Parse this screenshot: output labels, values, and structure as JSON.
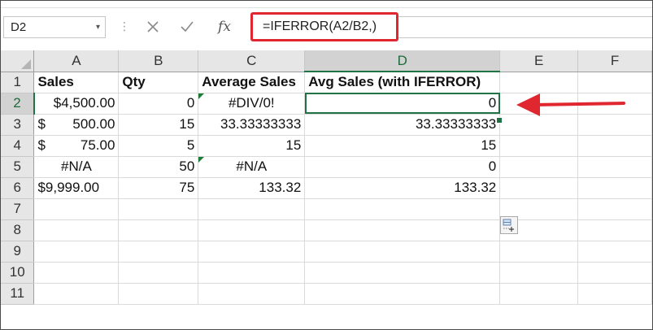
{
  "namebox": {
    "value": "D2"
  },
  "formula_bar": {
    "cancel_icon": "close-icon",
    "enter_icon": "check-icon",
    "fx_label": "fx",
    "formula": "=IFERROR(A2/B2,)"
  },
  "columns": [
    "A",
    "B",
    "C",
    "D",
    "E",
    "F"
  ],
  "selected_column": "D",
  "selected_row": "2",
  "rows": [
    {
      "num": "1",
      "cells": [
        "Sales",
        "Qty",
        "Average Sales",
        "Avg Sales (with IFERROR)",
        "",
        ""
      ]
    },
    {
      "num": "2",
      "cells": [
        "$4,500.00",
        "0",
        "#DIV/0!",
        "0",
        "",
        ""
      ]
    },
    {
      "num": "3",
      "cells": [
        "$",
        "15",
        "33.33333333",
        "33.33333333",
        "",
        ""
      ],
      "a_value": "500.00"
    },
    {
      "num": "4",
      "cells": [
        "$",
        "5",
        "15",
        "15",
        "",
        ""
      ],
      "a_value": "75.00"
    },
    {
      "num": "5",
      "cells": [
        "#N/A",
        "50",
        "#N/A",
        "0",
        "",
        ""
      ]
    },
    {
      "num": "6",
      "cells": [
        "$9,999.00",
        "75",
        "133.32",
        "133.32",
        "",
        ""
      ]
    },
    {
      "num": "7",
      "cells": [
        "",
        "",
        "",
        "",
        "",
        ""
      ]
    },
    {
      "num": "8",
      "cells": [
        "",
        "",
        "",
        "",
        "",
        ""
      ]
    },
    {
      "num": "9",
      "cells": [
        "",
        "",
        "",
        "",
        "",
        ""
      ]
    },
    {
      "num": "10",
      "cells": [
        "",
        "",
        "",
        "",
        "",
        ""
      ]
    },
    {
      "num": "11",
      "cells": [
        "",
        "",
        "",
        "",
        "",
        ""
      ]
    }
  ],
  "colors": {
    "highlight": "#e0262f",
    "selection": "#217346",
    "error_flag": "#1e7a37"
  }
}
